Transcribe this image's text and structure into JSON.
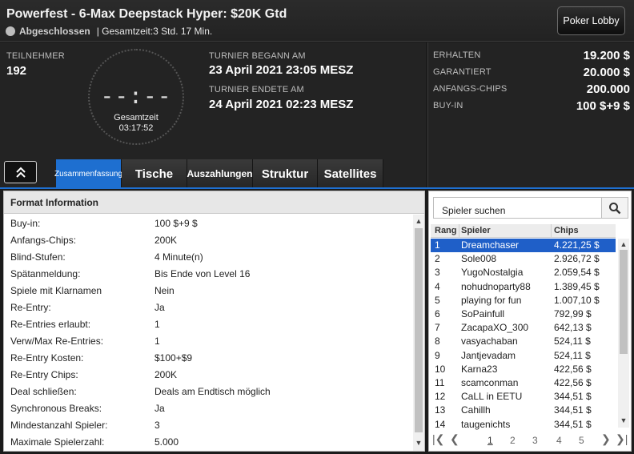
{
  "header": {
    "title": "Powerfest - 6-Max Deepstack Hyper: $20K Gtd",
    "status": "Abgeschlossen",
    "total_time_text": "| Gesamtzeit:3 Std.  17 Min.",
    "lobby_button": "Poker Lobby"
  },
  "info": {
    "participants_label": "TEILNEHMER",
    "participants_value": "192",
    "clock_display": "--:--",
    "clock_label": "Gesamtzeit",
    "clock_value": "03:17:52",
    "start_label": "TURNIER BEGANN AM",
    "start_value": "23 April 2021  23:05 MESZ",
    "end_label": "TURNIER ENDETE AM",
    "end_value": "24 April 2021  02:23 MESZ",
    "received_label": "ERHALTEN",
    "received_value": "19.200 $",
    "guarantee_label": "GARANTIERT",
    "guarantee_value": "20.000 $",
    "startchips_label": "ANFANGS-CHIPS",
    "startchips_value": "200.000",
    "buyin_label": "BUY-IN",
    "buyin_value": "100 $+9 $"
  },
  "tabs": [
    {
      "label": "Zusammenfassung",
      "active": true
    },
    {
      "label": "Tische",
      "active": false
    },
    {
      "label": "Auszahlungen",
      "active": false
    },
    {
      "label": "Struktur",
      "active": false
    },
    {
      "label": "Satellites",
      "active": false
    }
  ],
  "format": {
    "title": "Format Information",
    "rows": [
      {
        "k": "Buy-in:",
        "v": "100 $+9 $"
      },
      {
        "k": "Anfangs-Chips:",
        "v": "200K"
      },
      {
        "k": "Blind-Stufen:",
        "v": "4 Minute(n)"
      },
      {
        "k": "Spätanmeldung:",
        "v": "Bis Ende von Level 16"
      },
      {
        "k": "Spiele mit Klarnamen",
        "v": "Nein"
      },
      {
        "k": "Re-Entry:",
        "v": "Ja"
      },
      {
        "k": "Re-Entries erlaubt:",
        "v": "1"
      },
      {
        "k": "Verw/Max Re-Entries:",
        "v": "1"
      },
      {
        "k": "Re-Entry Kosten:",
        "v": "$100+$9"
      },
      {
        "k": "Re-Entry Chips:",
        "v": "200K"
      },
      {
        "k": "Deal schließen:",
        "v": "Deals am Endtisch möglich"
      },
      {
        "k": "Synchronous Breaks:",
        "v": "Ja"
      },
      {
        "k": "Mindestanzahl Spieler:",
        "v": "3"
      },
      {
        "k": "Maximale Spielerzahl:",
        "v": "5.000"
      }
    ]
  },
  "players": {
    "search_placeholder": "Spieler suchen",
    "columns": {
      "rank": "Rang",
      "player": "Spieler",
      "chips": "Chips"
    },
    "rows": [
      {
        "rank": "1",
        "name": "Dreamchaser",
        "chips": "4.221,25 $",
        "selected": true
      },
      {
        "rank": "2",
        "name": "Sole008",
        "chips": "2.926,72 $"
      },
      {
        "rank": "3",
        "name": "YugoNostalgia",
        "chips": "2.059,54 $"
      },
      {
        "rank": "4",
        "name": "nohudnoparty88",
        "chips": "1.389,45 $"
      },
      {
        "rank": "5",
        "name": "playing for fun",
        "chips": "1.007,10 $"
      },
      {
        "rank": "6",
        "name": "SoPainfull",
        "chips": "792,99 $"
      },
      {
        "rank": "7",
        "name": "ZacapaXO_300",
        "chips": "642,13 $"
      },
      {
        "rank": "8",
        "name": "vasyachaban",
        "chips": "524,11 $"
      },
      {
        "rank": "9",
        "name": "Jantjevadam",
        "chips": "524,11 $"
      },
      {
        "rank": "10",
        "name": "Karna23",
        "chips": "422,56 $"
      },
      {
        "rank": "11",
        "name": "scamconman",
        "chips": "422,56 $"
      },
      {
        "rank": "12",
        "name": "CaLL in EETU",
        "chips": "344,51 $"
      },
      {
        "rank": "13",
        "name": "Cahillh",
        "chips": "344,51 $"
      },
      {
        "rank": "14",
        "name": "taugenichts",
        "chips": "344,51 $"
      }
    ],
    "pages": [
      "1",
      "2",
      "3",
      "4",
      "5"
    ],
    "current_page": "1"
  },
  "colors": {
    "accent": "#1e6fd0",
    "selected_row": "#1f5fc8"
  }
}
